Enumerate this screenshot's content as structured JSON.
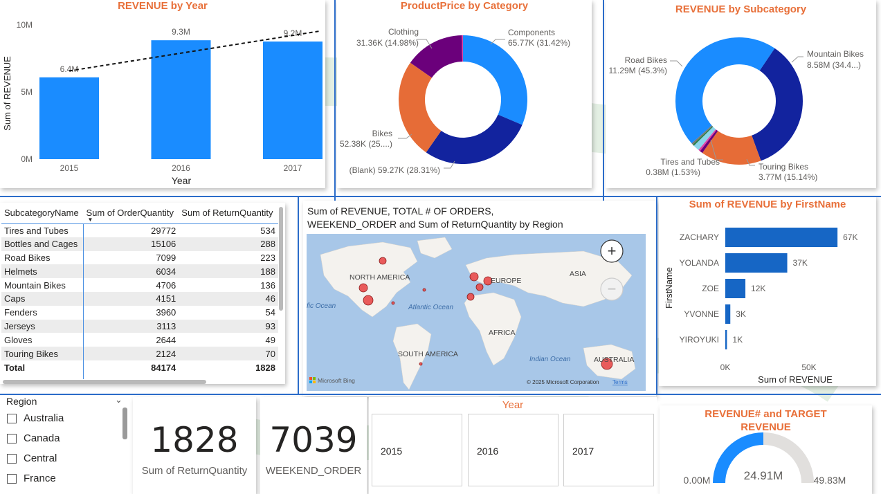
{
  "colors": {
    "accent": "#1a8cff",
    "title": "#e8703a",
    "navy": "#12239e",
    "orange": "#e66c37",
    "purple": "#6b007b",
    "bar_dark": "#1666c5"
  },
  "revenue_year": {
    "title": "REVENUE by Year",
    "ylabel": "Sum of REVENUE",
    "xlabel": "Year",
    "yticks": [
      "10M",
      "5M",
      "0M"
    ],
    "chart_data": {
      "type": "bar",
      "categories": [
        "2015",
        "2016",
        "2017"
      ],
      "values": [
        6.4,
        9.3,
        9.2
      ],
      "labels": [
        "6.4M",
        "9.3M",
        "9.2M"
      ],
      "ylim": [
        0,
        10.5
      ],
      "trendline": true
    }
  },
  "product_price": {
    "title": "ProductPrice by Category",
    "chart_data": {
      "type": "pie",
      "series": [
        {
          "name": "Components",
          "value": 65.77,
          "label": "65.77K (31.42%)",
          "color": "#1a8cff"
        },
        {
          "name": "(Blank)",
          "value": 59.27,
          "label": "59.27K (28.31%)",
          "color": "#12239e"
        },
        {
          "name": "Bikes",
          "value": 52.38,
          "label": "52.38K (25....)",
          "color": "#e66c37"
        },
        {
          "name": "Clothing",
          "value": 31.36,
          "label": "31.36K (14.98%)",
          "color": "#6b007b"
        },
        {
          "name": "",
          "value": 0.6,
          "label": "",
          "color": "#e044a7"
        }
      ]
    }
  },
  "revenue_subcat": {
    "title": "REVENUE by Subcategory",
    "chart_data": {
      "type": "pie",
      "series": [
        {
          "name": "Mountain Bikes",
          "value": 8.58,
          "label": "8.58M (34.4...)",
          "color": "#12239e"
        },
        {
          "name": "Touring Bikes",
          "value": 3.77,
          "label": "3.77M (15.14%)",
          "color": "#e66c37"
        },
        {
          "name": "",
          "value": 0.18,
          "label": "",
          "color": "#6b007b"
        },
        {
          "name": "",
          "value": 0.12,
          "label": "",
          "color": "#e044a7"
        },
        {
          "name": "Tires and Tubes",
          "value": 0.38,
          "label": "0.38M (1.53%)",
          "color": "#8ad4eb"
        },
        {
          "name": "",
          "value": 0.1,
          "label": "",
          "color": "#2d7f4a"
        },
        {
          "name": "",
          "value": 0.1,
          "label": "",
          "color": "#777777"
        },
        {
          "name": "Road Bikes",
          "value": 11.29,
          "label": "11.29M (45.3%)",
          "color": "#1a8cff"
        }
      ]
    }
  },
  "table": {
    "headers": [
      "SubcategoryName",
      "Sum of OrderQuantity",
      "Sum of ReturnQuantity"
    ],
    "rows": [
      [
        "Tires and Tubes",
        "29772",
        "534"
      ],
      [
        "Bottles and Cages",
        "15106",
        "288"
      ],
      [
        "Road Bikes",
        "7099",
        "223"
      ],
      [
        "Helmets",
        "6034",
        "188"
      ],
      [
        "Mountain Bikes",
        "4706",
        "136"
      ],
      [
        "Caps",
        "4151",
        "46"
      ],
      [
        "Fenders",
        "3960",
        "54"
      ],
      [
        "Jerseys",
        "3113",
        "93"
      ],
      [
        "Gloves",
        "2644",
        "49"
      ],
      [
        "Touring Bikes",
        "2124",
        "70"
      ]
    ],
    "total": [
      "Total",
      "84174",
      "1828"
    ]
  },
  "map": {
    "title_line1": "Sum of REVENUE, TOTAL # OF ORDERS,",
    "title_line2": "WEEKEND_ORDER and Sum of ReturnQuantity by Region",
    "labels": {
      "north_america": "NORTH AMERICA",
      "europe": "EUROPE",
      "asia": "ASIA",
      "africa": "AFRICA",
      "south_america": "SOUTH AMERICA",
      "australia": "AUSTRALIA",
      "atlantic": "Atlantic Ocean",
      "pacific": "fic Ocean",
      "indian": "Indian Ocean"
    },
    "bing": "Microsoft Bing",
    "copyright": "© 2025 Microsoft Corporation",
    "terms": "Terms",
    "zoom_in": "+",
    "zoom_out": "−"
  },
  "firstname": {
    "title": "Sum of REVENUE by FirstName",
    "ylabel": "FirstName",
    "xlabel": "Sum of REVENUE",
    "xticks": [
      "0K",
      "50K"
    ],
    "chart_data": {
      "type": "bar",
      "orientation": "horizontal",
      "categories": [
        "ZACHARY",
        "YOLANDA",
        "ZOE",
        "YVONNE",
        "YIROYUKI"
      ],
      "values": [
        67,
        37,
        12,
        3,
        1
      ],
      "labels": [
        "67K",
        "37K",
        "12K",
        "3K",
        "1K"
      ],
      "xlim": [
        0,
        70
      ]
    }
  },
  "region_slicer": {
    "title": "Region",
    "items": [
      "Australia",
      "Canada",
      "Central",
      "France"
    ]
  },
  "cards": [
    {
      "value": "1828",
      "label": "Sum of ReturnQuantity"
    },
    {
      "value": "7039",
      "label": "WEEKEND_ORDER"
    }
  ],
  "year_slicer": {
    "title": "Year",
    "items": [
      "2015",
      "2016",
      "2017"
    ]
  },
  "gauge": {
    "title_line1": "REVENUE# and TARGET",
    "title_line2": "REVENUE",
    "value": "24.91M",
    "min": "0.00M",
    "max": "49.83M",
    "fraction": 0.5
  }
}
